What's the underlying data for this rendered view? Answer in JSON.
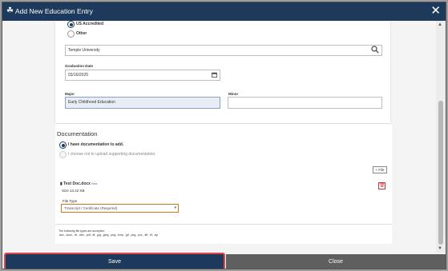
{
  "dialog": {
    "title": "Add New Education Entry",
    "title_icon": "graduation-cap-icon",
    "close_icon": "close-icon"
  },
  "accreditation": {
    "options": [
      {
        "label": "US Accredited",
        "checked": true
      },
      {
        "label": "Other",
        "checked": false
      }
    ]
  },
  "institution": {
    "value": "Temple University",
    "search_icon": "search-icon"
  },
  "graduation": {
    "label": "Graduation Date",
    "value": "03/16/2025",
    "calendar_icon": "calendar-icon"
  },
  "major": {
    "label": "Major",
    "value": "Early Childhood Education"
  },
  "minor": {
    "label": "Minor",
    "value": ""
  },
  "documentation": {
    "title": "Documentation",
    "options": [
      {
        "label": "I have documentation to add.",
        "checked": true
      },
      {
        "label": "I choose not to upload supporting documentation.",
        "checked": false
      }
    ],
    "add_file_label": "+ File",
    "file": {
      "name": "Test Doc.docx",
      "badge": "New",
      "size": "Size 13.42 KB",
      "file_icon": "document-icon",
      "delete_icon": "trash-icon"
    },
    "file_type": {
      "label": "File Type",
      "selected": "Transcript / Certificate (Required)"
    },
    "accepted": {
      "intro": "The following file types are accepted:",
      "types": ".doc, .docx, .rtf, .xlsx, .pdf, .tif, .jpg, .jpeg, .png, .bmp, .gif, .png, .pcx, .tiff, .tif, .zip"
    }
  },
  "footer": {
    "save_label": "Save",
    "close_label": "Close"
  },
  "colors": {
    "primary": "#1d3a5c",
    "close_button": "#5f5f5f",
    "highlight": "#e04848"
  }
}
